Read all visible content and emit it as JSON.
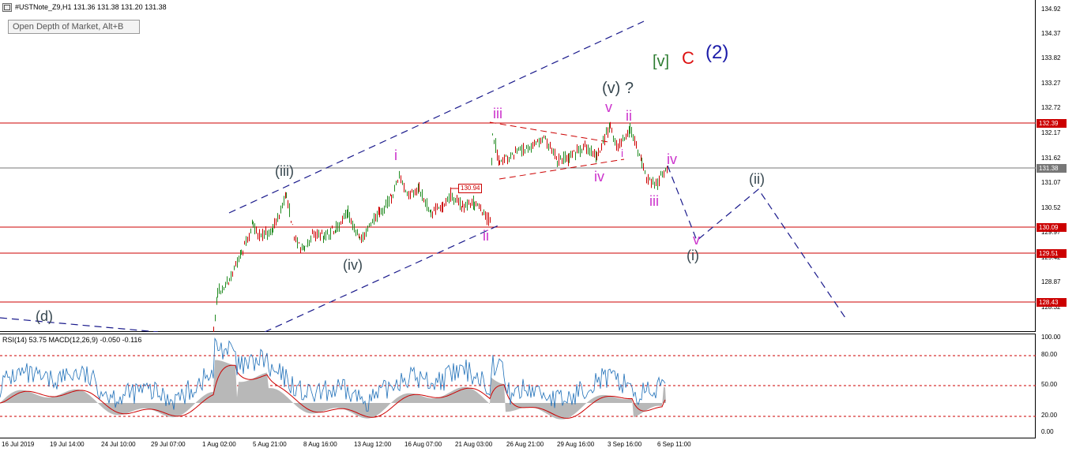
{
  "header": {
    "symbol_info": "#USTNote_Z9,H1  131.36 131.38 131.20 131.38"
  },
  "depth_button": {
    "label": "Open Depth of Market, Alt+B"
  },
  "indicator_header": "RSI(14) 53.75  MACD(12,26,9) -0.050 -0.116",
  "price_axis": [
    "134.92",
    "134.37",
    "133.82",
    "133.27",
    "132.72",
    "132.17",
    "131.62",
    "131.07",
    "130.52",
    "129.97",
    "129.42",
    "128.87",
    "128.32"
  ],
  "horizontal_levels": [
    {
      "label": "132.39",
      "color": "#cc0000"
    },
    {
      "label": "131.38",
      "color": "#777777"
    },
    {
      "label": "130.09",
      "color": "#cc0000"
    },
    {
      "label": "129.51",
      "color": "#cc0000"
    },
    {
      "label": "128.43",
      "color": "#cc0000"
    }
  ],
  "indicator_axis": [
    "100.00",
    "80.00",
    "50.00",
    "20.00",
    "0.00"
  ],
  "time_axis": [
    "16 Jul 2019",
    "19 Jul 14:00",
    "24 Jul 10:00",
    "29 Jul 07:00",
    "1 Aug 02:00",
    "5 Aug 21:00",
    "8 Aug 16:00",
    "13 Aug 12:00",
    "16 Aug 07:00",
    "21 Aug 03:00",
    "26 Aug 21:00",
    "29 Aug 16:00",
    "3 Sep 16:00",
    "6 Sep 11:00"
  ],
  "price_tag_mini": "130.94",
  "wave_labels": {
    "d": "(d)",
    "iii_big": "(iii)",
    "iv_big": "(iv)",
    "v_big": "(v) ?",
    "v_green": "[v]",
    "c_red": "C",
    "two_blue": "(2)",
    "i_pink": "i",
    "ii_pink_a": "ii",
    "iii_pink": "iii",
    "v_pink": "v",
    "ii_pink_b": "ii",
    "iv_pink_a": "iv",
    "iv_pink_b": "iv",
    "iii_pink_b": "iii",
    "v_pink_b": "v",
    "i_paren": "(i)",
    "ii_paren": "(ii)",
    "i_small": "i"
  },
  "colors": {
    "bull": "#228B22",
    "bear": "#cc0000",
    "channel": "#1a1a8c",
    "level_red": "#cc0000",
    "wave_pink": "#cc33cc",
    "wave_gray": "#37474f",
    "wave_green": "#2e7d32",
    "wave_red": "#dd1111",
    "wave_blue": "#1a1aa8",
    "rsi": "#1e6fb8",
    "macd_hist": "#b8b8b8",
    "macd_signal": "#cc0000"
  }
}
